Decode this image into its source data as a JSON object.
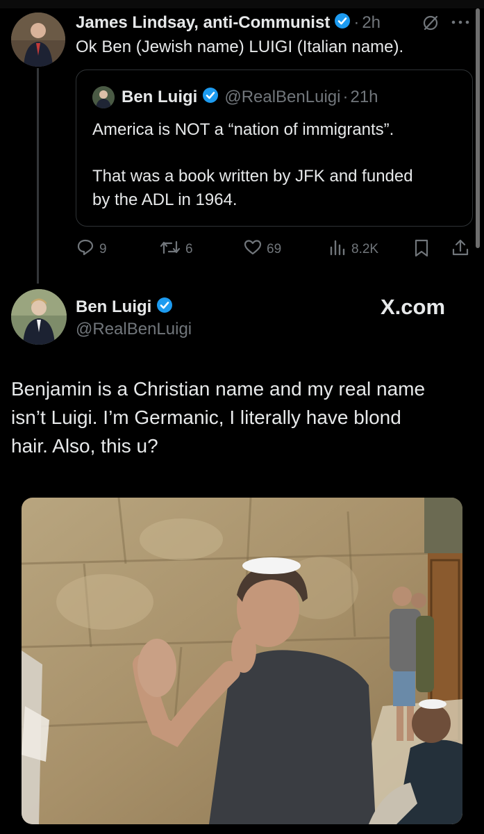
{
  "tweet1": {
    "author_name": "James Lindsay, anti-Communist",
    "time": "2h",
    "text": "Ok Ben (Jewish name) LUIGI (Italian name).",
    "quote": {
      "author_name": "Ben Luigi",
      "handle": "@RealBenLuigi",
      "time": "21h",
      "text_line1": "America is NOT a “nation of immigrants”.",
      "text_line2": "That was a book written by JFK and funded",
      "text_line3": "by the ADL in 1964."
    },
    "actions": {
      "replies": "9",
      "reposts": "6",
      "likes": "69",
      "views": "8.2K"
    }
  },
  "tweet2": {
    "author_name": "Ben Luigi",
    "handle": "@RealBenLuigi",
    "source": "X.com",
    "text_line1": "Benjamin is a Christian name and my real name",
    "text_line2": "isn’t Luigi. I’m Germanic, I literally have blond",
    "text_line3": "hair. Also, this u?"
  },
  "colors": {
    "background": "#000000",
    "text": "#e7e9ea",
    "muted": "#71767b",
    "verified": "#1d9bf0",
    "border": "#2f3336"
  },
  "icons": [
    "verified-badge-icon",
    "grok-icon",
    "more-icon",
    "reply-icon",
    "repost-icon",
    "like-icon",
    "views-icon",
    "bookmark-icon",
    "share-icon"
  ]
}
